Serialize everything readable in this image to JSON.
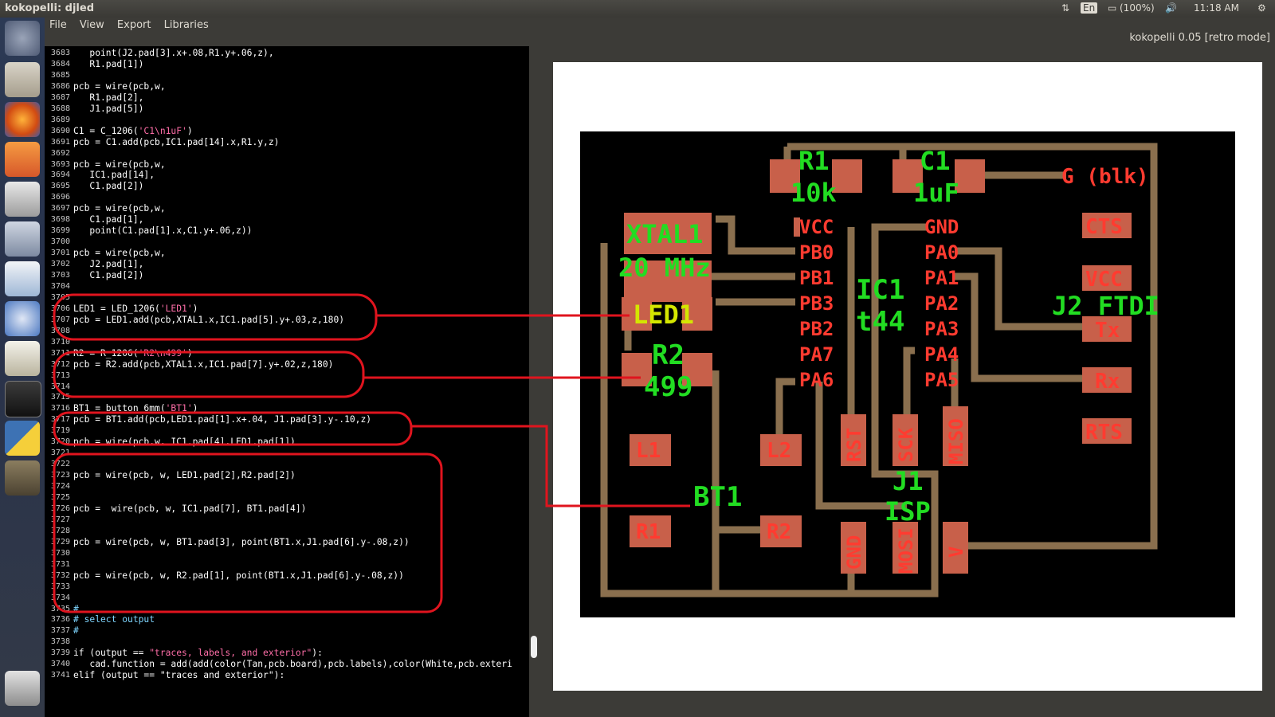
{
  "window": {
    "title": "kokopelli: djled",
    "app_version": "kokopelli 0.05 [retro mode]"
  },
  "menu": [
    "File",
    "View",
    "Export",
    "Libraries"
  ],
  "indicators": {
    "lang": "En",
    "battery": "(100%)",
    "time": "11:18 AM"
  },
  "editor": {
    "lines": [
      {
        "n": "3683",
        "t": "   point(J2.pad[3].x+.08,R1.y+.06,z),"
      },
      {
        "n": "3684",
        "t": "   R1.pad[1])"
      },
      {
        "n": "3685",
        "t": ""
      },
      {
        "n": "3686",
        "t": "pcb = wire(pcb,w,"
      },
      {
        "n": "3687",
        "t": "   R1.pad[2],"
      },
      {
        "n": "3688",
        "t": "   J1.pad[5])"
      },
      {
        "n": "3689",
        "t": ""
      },
      {
        "n": "3690",
        "t": "C1 = C_1206('C1\\n1uF')",
        "s": "'C1\\n1uF'"
      },
      {
        "n": "3691",
        "t": "pcb = C1.add(pcb,IC1.pad[14].x,R1.y,z)"
      },
      {
        "n": "3692",
        "t": ""
      },
      {
        "n": "3693",
        "t": "pcb = wire(pcb,w,"
      },
      {
        "n": "3694",
        "t": "   IC1.pad[14],"
      },
      {
        "n": "3695",
        "t": "   C1.pad[2])"
      },
      {
        "n": "3696",
        "t": ""
      },
      {
        "n": "3697",
        "t": "pcb = wire(pcb,w,"
      },
      {
        "n": "3698",
        "t": "   C1.pad[1],"
      },
      {
        "n": "3699",
        "t": "   point(C1.pad[1].x,C1.y+.06,z))"
      },
      {
        "n": "3700",
        "t": ""
      },
      {
        "n": "3701",
        "t": "pcb = wire(pcb,w,"
      },
      {
        "n": "3702",
        "t": "   J2.pad[1],"
      },
      {
        "n": "3703",
        "t": "   C1.pad[2])"
      },
      {
        "n": "3704",
        "t": ""
      },
      {
        "n": "3705",
        "t": ""
      },
      {
        "n": "3706",
        "t": "LED1 = LED_1206('LED1')",
        "s": "'LED1'"
      },
      {
        "n": "3707",
        "t": "pcb = LED1.add(pcb,XTAL1.x,IC1.pad[5].y+.03,z,180)"
      },
      {
        "n": "3708",
        "t": ""
      },
      {
        "n": "3710",
        "t": ""
      },
      {
        "n": "3711",
        "t": "R2 = R_1206('R2\\n499')",
        "s": "'R2\\n499'"
      },
      {
        "n": "3712",
        "t": "pcb = R2.add(pcb,XTAL1.x,IC1.pad[7].y+.02,z,180)"
      },
      {
        "n": "3713",
        "t": ""
      },
      {
        "n": "3714",
        "t": ""
      },
      {
        "n": "3715",
        "t": ""
      },
      {
        "n": "3716",
        "t": "BT1 = button_6mm('BT1')",
        "s": "'BT1'"
      },
      {
        "n": "3717",
        "t": "pcb = BT1.add(pcb,LED1.pad[1].x+.04, J1.pad[3].y-.10,z)"
      },
      {
        "n": "3719",
        "t": ""
      },
      {
        "n": "3720",
        "t": "pcb = wire(pcb,w, IC1.pad[4],LED1.pad[1])"
      },
      {
        "n": "3721",
        "t": ""
      },
      {
        "n": "3722",
        "t": ""
      },
      {
        "n": "3723",
        "t": "pcb = wire(pcb, w, LED1.pad[2],R2.pad[2])"
      },
      {
        "n": "3724",
        "t": ""
      },
      {
        "n": "3725",
        "t": ""
      },
      {
        "n": "3726",
        "t": "pcb =  wire(pcb, w, IC1.pad[7], BT1.pad[4])"
      },
      {
        "n": "3727",
        "t": ""
      },
      {
        "n": "3728",
        "t": ""
      },
      {
        "n": "3729",
        "t": "pcb = wire(pcb, w, BT1.pad[3], point(BT1.x,J1.pad[6].y-.08,z))"
      },
      {
        "n": "3730",
        "t": ""
      },
      {
        "n": "3731",
        "t": ""
      },
      {
        "n": "3732",
        "t": "pcb = wire(pcb, w, R2.pad[1], point(BT1.x,J1.pad[6].y-.08,z))"
      },
      {
        "n": "3733",
        "t": ""
      },
      {
        "n": "3734",
        "t": ""
      },
      {
        "n": "3735",
        "t": "#",
        "c": true
      },
      {
        "n": "3736",
        "t": "# select output",
        "c": true
      },
      {
        "n": "3737",
        "t": "#",
        "c": true
      },
      {
        "n": "3738",
        "t": ""
      },
      {
        "n": "3739",
        "t": "if (output == \"traces, labels, and exterior\"):",
        "s": "\"traces, labels, and exterior\""
      },
      {
        "n": "3740",
        "t": "   cad.function = add(add(color(Tan,pcb.board),pcb.labels),color(White,pcb.exteri"
      },
      {
        "n": "3741",
        "t": "elif (output == \"traces and exterior\"):"
      }
    ]
  },
  "pcb": {
    "pad_labels": [
      "VCC",
      "PB0",
      "PB1",
      "PB3",
      "PB2",
      "PA7",
      "PA6",
      "GND",
      "PA0",
      "PA1",
      "PA2",
      "PA3",
      "PA4",
      "PA5",
      "CTS",
      "VCC",
      "Tx",
      "Rx",
      "RTS",
      "L1",
      "L2",
      "R1",
      "R2",
      "G (blk)",
      "RST",
      "SCK",
      "MISO",
      "GND",
      "MOSI",
      "V"
    ],
    "part_labels": [
      "R1",
      "10k",
      "C1",
      "1uF",
      "XTAL1",
      "20 MHz",
      "IC1",
      "t44",
      "J2 FTDI",
      "LED1",
      "R2",
      "499",
      "J1",
      "ISP",
      "BT1"
    ]
  }
}
